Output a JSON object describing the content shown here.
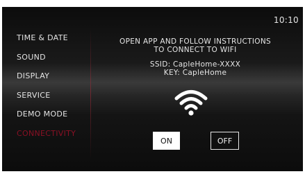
{
  "status": {
    "time": "10:10"
  },
  "menu": {
    "items": [
      {
        "label": "TIME & DATE",
        "active": false
      },
      {
        "label": "SOUND",
        "active": false
      },
      {
        "label": "DISPLAY",
        "active": false
      },
      {
        "label": "SERVICE",
        "active": false
      },
      {
        "label": "DEMO MODE",
        "active": false
      },
      {
        "label": "CONNECTIVITY",
        "active": true
      }
    ]
  },
  "connectivity": {
    "instruction_line1": "OPEN APP AND FOLLOW INSTRUCTIONS",
    "instruction_line2": "TO CONNECT TO WIFI",
    "ssid": "SSID: CapleHome-XXXX",
    "key": "KEY: CapleHome",
    "icon": "wifi-icon",
    "on_label": "ON",
    "off_label": "OFF",
    "selected": "ON"
  },
  "colors": {
    "accent": "#8a1024",
    "text": "#e6e6e6",
    "background": "#101010"
  }
}
